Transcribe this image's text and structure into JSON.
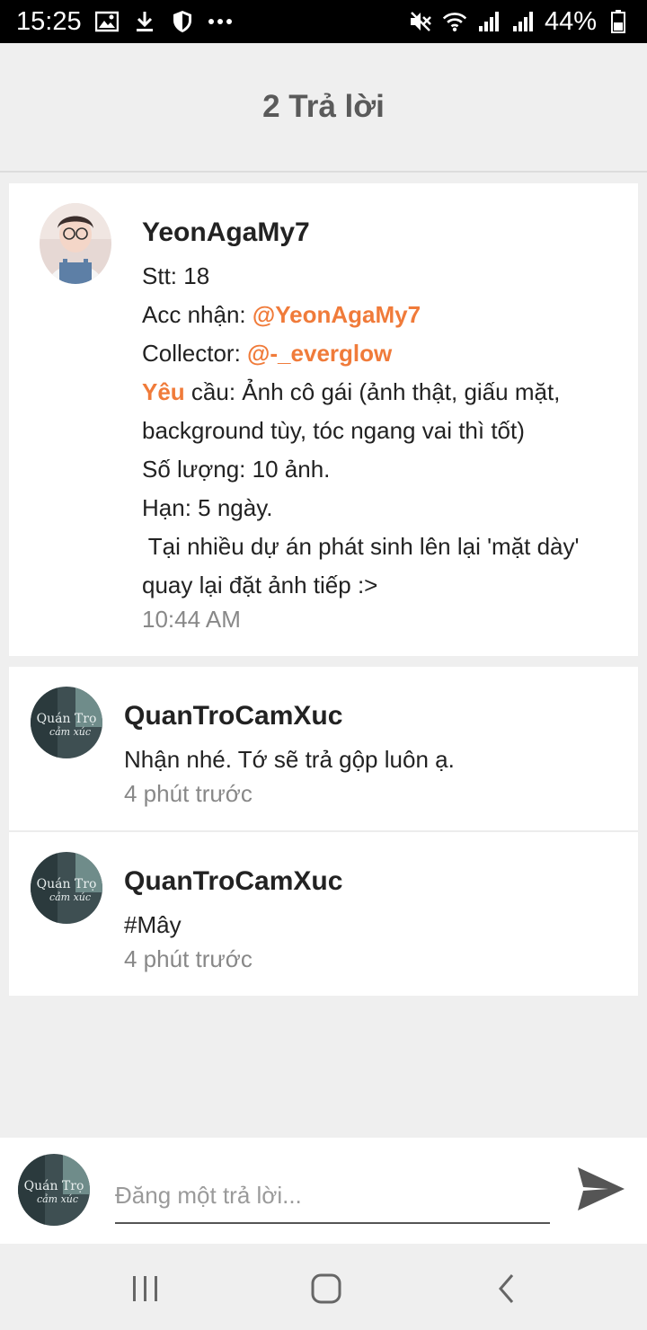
{
  "status_bar": {
    "time": "15:25",
    "battery": "44%",
    "left_icons": [
      "image-icon",
      "download-icon",
      "shield-icon",
      "more-icon"
    ],
    "right_icons": [
      "mute-icon",
      "wifi-icon",
      "signal-icon",
      "signal-icon",
      "battery-icon"
    ]
  },
  "header": {
    "title": "2 Trả lời"
  },
  "post": {
    "username": "YeonAgaMy7",
    "lines": {
      "stt": "Stt: 18",
      "acc_prefix": "Acc nhận: ",
      "acc_mention": "@YeonAgaMy7",
      "collector_prefix": "Collector: ",
      "collector_mention": "@-_everglow",
      "yeu": "Yêu",
      "request_rest": " cầu: Ảnh cô gái (ảnh thật, giấu mặt,",
      "request_line2": "background tùy, tóc ngang vai thì tốt)",
      "quantity": "Số lượng: 10 ảnh.",
      "deadline": "Hạn: 5 ngày.",
      "note_line1": " Tại nhiều dự án phát sinh lên lại 'mặt dày'",
      "note_line2": "quay lại đặt ảnh tiếp :>"
    },
    "time": "10:44 AM"
  },
  "replies": [
    {
      "username": "QuanTroCamXuc",
      "text": "Nhận nhé. Tớ sẽ trả gộp luôn ạ.",
      "time": "4 phút trước",
      "avatar_text": [
        "Quán Trọ",
        "cảm xúc"
      ]
    },
    {
      "username": "QuanTroCamXuc",
      "text": "#Mây",
      "time": "4 phút trước",
      "avatar_text": [
        "Quán Trọ",
        "cảm xúc"
      ]
    }
  ],
  "composer": {
    "placeholder": "Đăng một trả lời...",
    "avatar_text": [
      "Quán Trọ",
      "cảm xúc"
    ],
    "send_icon": "send-icon"
  },
  "nav": {
    "icons": [
      "recent-apps-icon",
      "home-icon",
      "back-icon"
    ]
  },
  "colors": {
    "mention": "#f07b3a",
    "header_text": "#5a5a5a",
    "background": "#efefef"
  }
}
